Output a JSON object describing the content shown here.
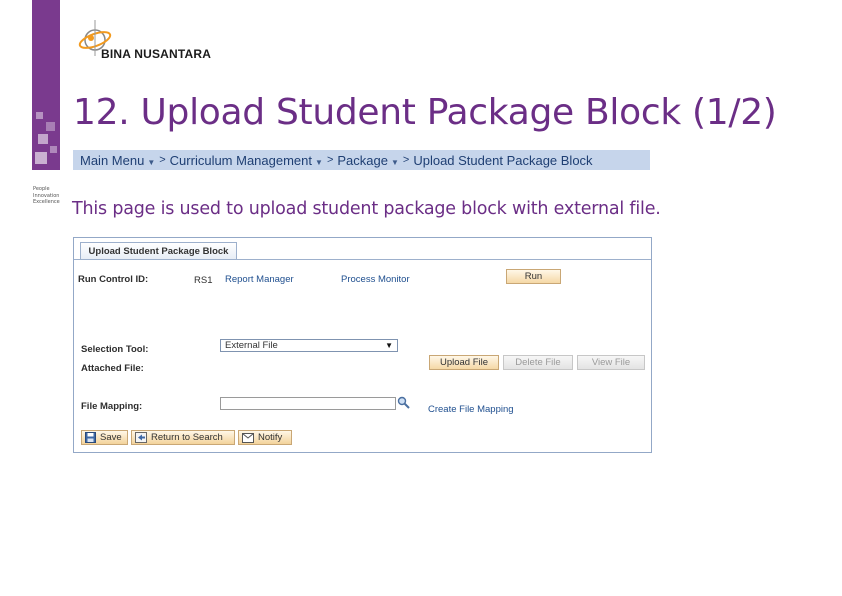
{
  "logo": {
    "text": "BINA NUSANTARA"
  },
  "tagline": [
    "People",
    "Innovation",
    "Excellence"
  ],
  "slide": {
    "title": "12. Upload Student Package Block (1/2)",
    "description": "This page is used to upload student package block with external file."
  },
  "breadcrumb": {
    "items": [
      "Main Menu",
      "Curriculum Management",
      "Package",
      "Upload Student Package Block"
    ],
    "separator": ">"
  },
  "panel": {
    "tab_label": "Upload Student Package Block",
    "run_control_label": "Run Control ID:",
    "run_control_value": "RS1",
    "report_manager_link": "Report Manager",
    "process_monitor_link": "Process Monitor",
    "run_button": "Run",
    "selection_tool_label": "Selection Tool:",
    "selection_tool_value": "External File",
    "attached_file_label": "Attached File:",
    "upload_file_button": "Upload File",
    "delete_file_button": "Delete File",
    "view_file_button": "View File",
    "file_mapping_label": "File Mapping:",
    "file_mapping_value": "",
    "create_file_mapping_link": "Create File Mapping"
  },
  "toolbar": {
    "save": "Save",
    "return_to_search": "Return to Search",
    "notify": "Notify"
  },
  "colors": {
    "title_purple": "#6b2e86",
    "breadcrumb_bg": "#c6d5eb",
    "link_blue": "#1f4f8f",
    "button_orange": "#f5d8a6"
  }
}
